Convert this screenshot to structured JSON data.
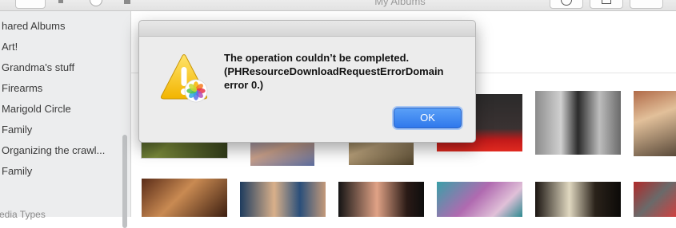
{
  "window": {
    "title": "My Albums"
  },
  "toolbar": {
    "back_icon": "chevron-left-icon",
    "slider_icon": "zoom-slider-icon",
    "info_icon": "info-icon",
    "share_icon": "share-icon",
    "favorite_icon": "heart-icon"
  },
  "sidebar": {
    "items": [
      {
        "label": "hared Albums",
        "type": "header"
      },
      {
        "label": "Art!"
      },
      {
        "label": "Grandma's stuff"
      },
      {
        "label": "Firearms"
      },
      {
        "label": "Marigold Circle"
      },
      {
        "label": "Family"
      },
      {
        "label": "Organizing the crawl..."
      },
      {
        "label": "Family"
      },
      {
        "label": "edia Types",
        "type": "header"
      }
    ]
  },
  "dialog": {
    "icon": "caution-photos-icon",
    "message_line1": "The operation couldn’t be completed.",
    "message_line2": "(PHResourceDownloadRequestErrorDomain",
    "message_line3": "error 0.)",
    "ok_label": "OK"
  },
  "colors": {
    "accent": "#3b82f0",
    "sidebar_bg": "#ecedee",
    "dialog_bg": "#ececec"
  }
}
